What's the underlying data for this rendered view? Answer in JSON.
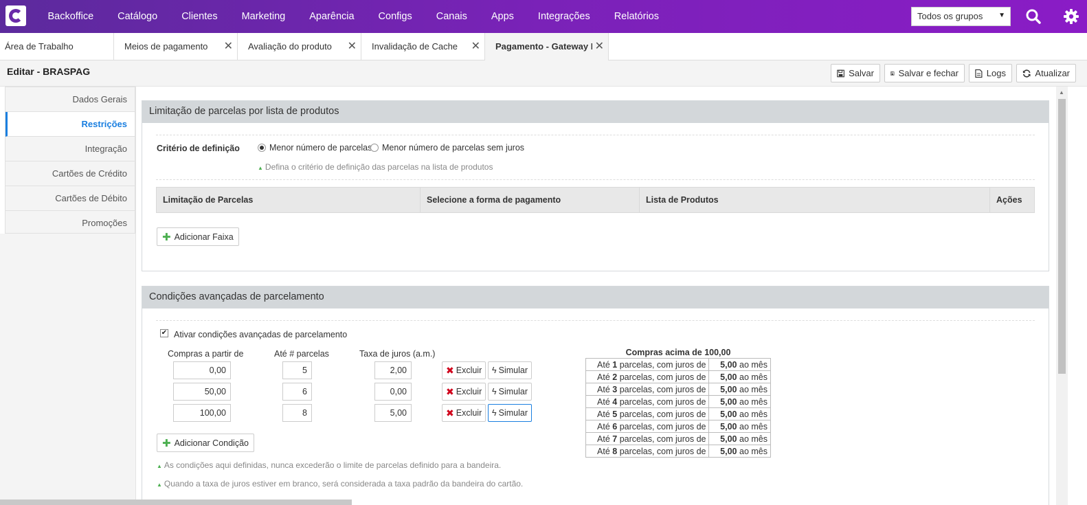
{
  "topbar": {
    "nav": [
      "Backoffice",
      "Catálogo",
      "Clientes",
      "Marketing",
      "Aparência",
      "Configs",
      "Canais",
      "Apps",
      "Integrações",
      "Relatórios"
    ],
    "group_select": "Todos os grupos",
    "brand_color": "#7a22b8"
  },
  "tabs": [
    {
      "label": "Área de Trabalho",
      "closable": false
    },
    {
      "label": "Meios de pagamento",
      "closable": true
    },
    {
      "label": "Avaliação do produto",
      "closable": true
    },
    {
      "label": "Invalidação de Cache",
      "closable": true
    },
    {
      "label": "Pagamento - Gateway Br",
      "closable": true,
      "active": true
    }
  ],
  "header": {
    "title": "Editar - BRASPAG",
    "save": "Salvar",
    "save_close": "Salvar e fechar",
    "logs": "Logs",
    "refresh": "Atualizar"
  },
  "sidebar": {
    "items": [
      "Dados Gerais",
      "Restrições",
      "Integração",
      "Cartões de Crédito",
      "Cartões de Débito",
      "Promoções"
    ],
    "active": "Restrições",
    "accent": "#1a7fe0"
  },
  "panel1": {
    "title": "Limitação de parcelas por lista de produtos",
    "criterion_label": "Critério de definição",
    "option1": "Menor número de parcelas",
    "option2": "Menor número de parcelas sem juros",
    "selected": "Menor número de parcelas",
    "hint": "Defina o critério de definição das parcelas na lista de produtos",
    "columns": [
      "Limitação de Parcelas",
      "Selecione a forma de pagamento",
      "Lista de Produtos",
      "Ações"
    ],
    "add_button": "Adicionar Faixa"
  },
  "panel2": {
    "title": "Condições avançadas de parcelamento",
    "checkbox_label": "Ativar condições avançadas de parcelamento",
    "checked": true,
    "col_from": "Compras a partir de",
    "col_max": "Até # parcelas",
    "col_rate": "Taxa de juros (a.m.)",
    "rows": [
      {
        "from": "0,00",
        "max": "5",
        "rate": "2,00"
      },
      {
        "from": "50,00",
        "max": "6",
        "rate": "0,00"
      },
      {
        "from": "100,00",
        "max": "8",
        "rate": "5,00"
      }
    ],
    "delete_label": "Excluir",
    "simulate_label": "Simular",
    "add_button": "Adicionar Condição",
    "hint1": "As condições aqui definidas, nunca excederão o limite de parcelas definido para a bandeira.",
    "hint2": "Quando a taxa de juros estiver em branco, será considerada a taxa padrão da bandeira do cartão.",
    "sim_title": "Compras acima de 100,00",
    "sim_rows": [
      {
        "prefix": "Até",
        "n": "1",
        "mid": "parcelas, com juros de",
        "rate": "5,00",
        "suffix": "ao mês"
      },
      {
        "prefix": "Até",
        "n": "2",
        "mid": "parcelas, com juros de",
        "rate": "5,00",
        "suffix": "ao mês"
      },
      {
        "prefix": "Até",
        "n": "3",
        "mid": "parcelas, com juros de",
        "rate": "5,00",
        "suffix": "ao mês"
      },
      {
        "prefix": "Até",
        "n": "4",
        "mid": "parcelas, com juros de",
        "rate": "5,00",
        "suffix": "ao mês"
      },
      {
        "prefix": "Até",
        "n": "5",
        "mid": "parcelas, com juros de",
        "rate": "5,00",
        "suffix": "ao mês"
      },
      {
        "prefix": "Até",
        "n": "6",
        "mid": "parcelas, com juros de",
        "rate": "5,00",
        "suffix": "ao mês"
      },
      {
        "prefix": "Até",
        "n": "7",
        "mid": "parcelas, com juros de",
        "rate": "5,00",
        "suffix": "ao mês"
      },
      {
        "prefix": "Até",
        "n": "8",
        "mid": "parcelas, com juros de",
        "rate": "5,00",
        "suffix": "ao mês"
      }
    ]
  }
}
